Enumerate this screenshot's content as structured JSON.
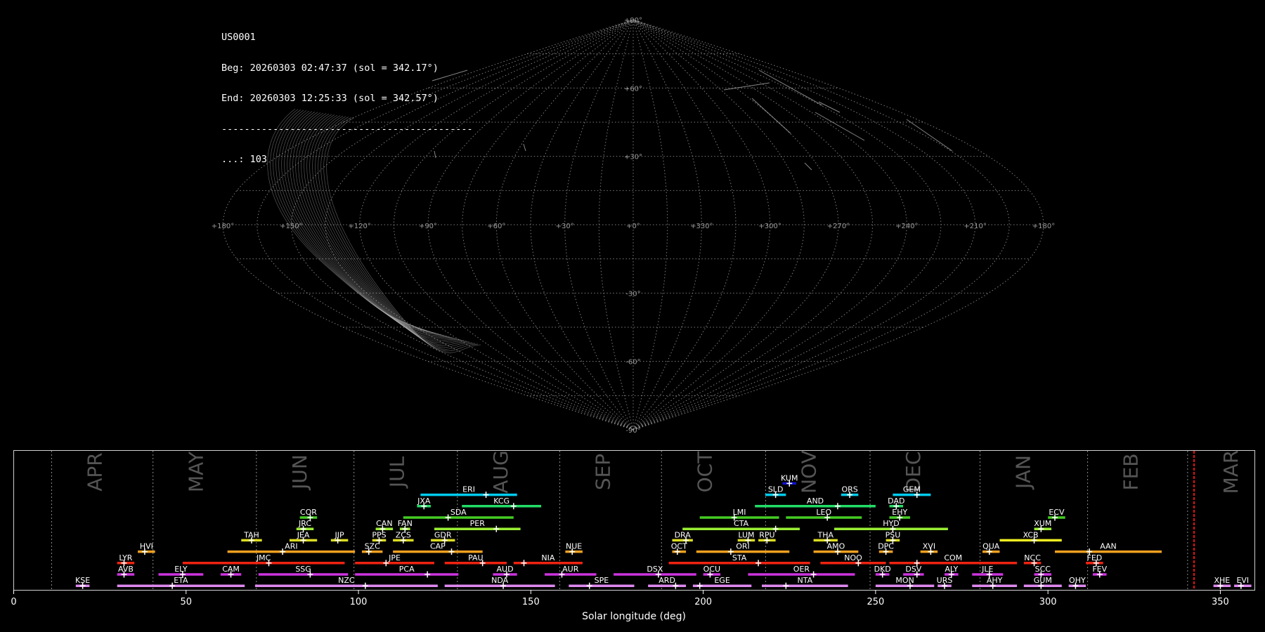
{
  "info": {
    "id": "US0001",
    "beg": "Beg: 20260303 02:47:37 (sol = 342.17°)",
    "end": "End: 20260303 12:25:33 (sol = 342.57°)",
    "sep": "--------------------------------------------",
    "count": "...: 103"
  },
  "skymap": {
    "lat_labels": [
      "+90°",
      "+60°",
      "+30°",
      "-30°",
      "-60°",
      "-90°"
    ],
    "lat_values": [
      90,
      60,
      30,
      -30,
      -60,
      -90
    ],
    "lon_labels": [
      "+180°",
      "+150°",
      "+120°",
      "+90°",
      "+60°",
      "+30°",
      "+0°",
      "+330°",
      "+300°",
      "+270°",
      "+240°",
      "+210°",
      "+180°"
    ],
    "grid_color": "#9a9a9a"
  },
  "chart_data": {
    "type": "timeline",
    "xlabel": "Solar longitude (deg)",
    "xlim": [
      0,
      360
    ],
    "xticks": [
      0,
      50,
      100,
      150,
      200,
      250,
      300,
      350
    ],
    "current_sol": 342.37,
    "months": [
      {
        "name": "APR",
        "start": 11
      },
      {
        "name": "MAY",
        "start": 40.4
      },
      {
        "name": "JUN",
        "start": 70.4
      },
      {
        "name": "JUL",
        "start": 98.7
      },
      {
        "name": "AUG",
        "start": 128.7
      },
      {
        "name": "SEP",
        "start": 158.4
      },
      {
        "name": "OCT",
        "start": 187.9
      },
      {
        "name": "NOV",
        "start": 218.1
      },
      {
        "name": "DEC",
        "start": 248.4
      },
      {
        "name": "JAN",
        "start": 280.3
      },
      {
        "name": "FEB",
        "start": 311.5
      },
      {
        "name": "MAR",
        "start": 340.5
      }
    ],
    "showers": [
      {
        "code": "KUM",
        "start": 223,
        "end": 227,
        "peak": 225,
        "row": 8,
        "color": "#1010d0"
      },
      {
        "code": "ERI",
        "start": 118,
        "end": 146,
        "peak": 137,
        "row": 7,
        "color": "#00ccee"
      },
      {
        "code": "SLD",
        "start": 218,
        "end": 224,
        "peak": 221,
        "row": 7,
        "color": "#00ccee"
      },
      {
        "code": "ORS",
        "start": 240,
        "end": 245,
        "peak": 242.5,
        "row": 7,
        "color": "#00ccee"
      },
      {
        "code": "GEM",
        "start": 255,
        "end": 266,
        "peak": 262,
        "row": 7,
        "color": "#00ccee"
      },
      {
        "code": "JXA",
        "start": 117,
        "end": 121,
        "peak": 119,
        "row": 6,
        "color": "#22dd66"
      },
      {
        "code": "KCG",
        "start": 130,
        "end": 153,
        "peak": 145,
        "row": 6,
        "color": "#22dd66"
      },
      {
        "code": "AND",
        "start": 215,
        "end": 250,
        "peak": 239,
        "row": 6,
        "color": "#22dd66"
      },
      {
        "code": "DAD",
        "start": 254,
        "end": 258,
        "peak": 256,
        "row": 6,
        "color": "#22dd66"
      },
      {
        "code": "COR",
        "start": 83,
        "end": 88,
        "peak": 86,
        "row": 5,
        "color": "#44cc22"
      },
      {
        "code": "SDA",
        "start": 113,
        "end": 145,
        "peak": 126,
        "row": 5,
        "color": "#44cc22"
      },
      {
        "code": "LMI",
        "start": 199,
        "end": 222,
        "peak": 209,
        "row": 5,
        "color": "#44cc22"
      },
      {
        "code": "LEO",
        "start": 224,
        "end": 246,
        "peak": 236,
        "row": 5,
        "color": "#44cc22"
      },
      {
        "code": "EHY",
        "start": 254,
        "end": 260,
        "peak": 257,
        "row": 5,
        "color": "#44cc22"
      },
      {
        "code": "ECV",
        "start": 300,
        "end": 305,
        "peak": 302,
        "row": 5,
        "color": "#44cc22"
      },
      {
        "code": "JRC",
        "start": 82,
        "end": 87,
        "peak": 84,
        "row": 4,
        "color": "#99ee33"
      },
      {
        "code": "CAN",
        "start": 105,
        "end": 110,
        "peak": 107,
        "row": 4,
        "color": "#99ee33"
      },
      {
        "code": "FAN",
        "start": 112,
        "end": 115,
        "peak": 113.5,
        "row": 4,
        "color": "#99ee33"
      },
      {
        "code": "PER",
        "start": 122,
        "end": 147,
        "peak": 140,
        "row": 4,
        "color": "#99ee33"
      },
      {
        "code": "CTA",
        "start": 194,
        "end": 228,
        "peak": 221,
        "row": 4,
        "color": "#99ee33"
      },
      {
        "code": "HYD",
        "start": 238,
        "end": 271,
        "peak": 255,
        "row": 4,
        "color": "#99ee33"
      },
      {
        "code": "XUM",
        "start": 296,
        "end": 301,
        "peak": 298,
        "row": 4,
        "color": "#99ee33"
      },
      {
        "code": "TAH",
        "start": 66,
        "end": 72,
        "peak": 69,
        "row": 3,
        "color": "#dddd22"
      },
      {
        "code": "JEA",
        "start": 80,
        "end": 88,
        "peak": 84,
        "row": 3,
        "color": "#dddd22"
      },
      {
        "code": "JIP",
        "start": 92,
        "end": 97,
        "peak": 94,
        "row": 3,
        "color": "#dddd22"
      },
      {
        "code": "PPS",
        "start": 104,
        "end": 108,
        "peak": 106,
        "row": 3,
        "color": "#dddd22"
      },
      {
        "code": "ZCS",
        "start": 110,
        "end": 116,
        "peak": 113,
        "row": 3,
        "color": "#dddd22"
      },
      {
        "code": "GDR",
        "start": 121,
        "end": 128,
        "peak": 125,
        "row": 3,
        "color": "#dddd22"
      },
      {
        "code": "DRA",
        "start": 191,
        "end": 197,
        "peak": 195,
        "row": 3,
        "color": "#dddd22"
      },
      {
        "code": "LUM",
        "start": 210,
        "end": 215,
        "peak": 213,
        "row": 3,
        "color": "#dddd22"
      },
      {
        "code": "RPU",
        "start": 216,
        "end": 221,
        "peak": 218.5,
        "row": 3,
        "color": "#dddd22"
      },
      {
        "code": "THA",
        "start": 232,
        "end": 239,
        "peak": 236,
        "row": 3,
        "color": "#dddd22"
      },
      {
        "code": "PSU",
        "start": 253,
        "end": 257,
        "peak": 255,
        "row": 3,
        "color": "#dddd22"
      },
      {
        "code": "XCB",
        "start": 286,
        "end": 304,
        "peak": 296,
        "row": 3,
        "color": "#eeee22"
      },
      {
        "code": "HVI",
        "start": 36,
        "end": 41,
        "peak": 38,
        "row": 2,
        "color": "#f0a020"
      },
      {
        "code": "ARI",
        "start": 62,
        "end": 99,
        "peak": 78,
        "row": 2,
        "color": "#f0a020"
      },
      {
        "code": "SZC",
        "start": 101,
        "end": 107,
        "peak": 103,
        "row": 2,
        "color": "#f0a020"
      },
      {
        "code": "CAP",
        "start": 110,
        "end": 136,
        "peak": 127,
        "row": 2,
        "color": "#f0a020"
      },
      {
        "code": "NUE",
        "start": 160,
        "end": 165,
        "peak": 162,
        "row": 2,
        "color": "#f0a020"
      },
      {
        "code": "OCT",
        "start": 191,
        "end": 195,
        "peak": 192.5,
        "row": 2,
        "color": "#f0a020"
      },
      {
        "code": "ORI",
        "start": 198,
        "end": 225,
        "peak": 208,
        "row": 2,
        "color": "#f0a020"
      },
      {
        "code": "AMO",
        "start": 232,
        "end": 245,
        "peak": 239,
        "row": 2,
        "color": "#f0a020"
      },
      {
        "code": "DPC",
        "start": 251,
        "end": 255,
        "peak": 253,
        "row": 2,
        "color": "#f0a020"
      },
      {
        "code": "XVI",
        "start": 263,
        "end": 268,
        "peak": 266,
        "row": 2,
        "color": "#f0a020"
      },
      {
        "code": "QUA",
        "start": 281,
        "end": 286,
        "peak": 283,
        "row": 2,
        "color": "#f0a020"
      },
      {
        "code": "AAN",
        "start": 302,
        "end": 333,
        "peak": 312,
        "row": 2,
        "color": "#f0a020"
      },
      {
        "code": "LYR",
        "start": 30,
        "end": 35,
        "peak": 32,
        "row": 1,
        "color": "#ee2211"
      },
      {
        "code": "JMC",
        "start": 49,
        "end": 96,
        "peak": 74,
        "row": 1,
        "color": "#ee2211"
      },
      {
        "code": "JPE",
        "start": 99,
        "end": 122,
        "peak": 108,
        "row": 1,
        "color": "#ee2211"
      },
      {
        "code": "PAU",
        "start": 125,
        "end": 143,
        "peak": 136,
        "row": 1,
        "color": "#ee2211"
      },
      {
        "code": "NIA",
        "start": 145,
        "end": 165,
        "peak": 148,
        "row": 1,
        "color": "#ee2211"
      },
      {
        "code": "STA",
        "start": 190,
        "end": 231,
        "peak": 216,
        "row": 1,
        "color": "#ee2211"
      },
      {
        "code": "NOO",
        "start": 234,
        "end": 253,
        "peak": 245,
        "row": 1,
        "color": "#ee2211"
      },
      {
        "code": "COM",
        "start": 254,
        "end": 291,
        "peak": 262,
        "row": 1,
        "color": "#ee2211"
      },
      {
        "code": "NCC",
        "start": 293,
        "end": 298,
        "peak": 296,
        "row": 1,
        "color": "#ee2211"
      },
      {
        "code": "FED",
        "start": 311,
        "end": 316,
        "peak": 314,
        "row": 1,
        "color": "#ee2211"
      },
      {
        "code": "AVB",
        "start": 30,
        "end": 35,
        "peak": 32,
        "row": 0,
        "color": "#cc33dd"
      },
      {
        "code": "ELY",
        "start": 42,
        "end": 55,
        "peak": 49,
        "row": 0,
        "color": "#cc33dd"
      },
      {
        "code": "CAM",
        "start": 60,
        "end": 66,
        "peak": 63,
        "row": 0,
        "color": "#cc33dd"
      },
      {
        "code": "SSG",
        "start": 71,
        "end": 97,
        "peak": 86,
        "row": 0,
        "color": "#cc33dd"
      },
      {
        "code": "PCA",
        "start": 99,
        "end": 129,
        "peak": 120,
        "row": 0,
        "color": "#cc33dd"
      },
      {
        "code": "AUD",
        "start": 139,
        "end": 146,
        "peak": 143,
        "row": 0,
        "color": "#cc33dd"
      },
      {
        "code": "AUR",
        "start": 154,
        "end": 169,
        "peak": 159,
        "row": 0,
        "color": "#cc33dd"
      },
      {
        "code": "DSX",
        "start": 174,
        "end": 198,
        "peak": 187,
        "row": 0,
        "color": "#cc33dd"
      },
      {
        "code": "OCU",
        "start": 200,
        "end": 205,
        "peak": 202,
        "row": 0,
        "color": "#cc33dd"
      },
      {
        "code": "OER",
        "start": 213,
        "end": 244,
        "peak": 232,
        "row": 0,
        "color": "#cc33dd"
      },
      {
        "code": "DKD",
        "start": 250,
        "end": 254,
        "peak": 252,
        "row": 0,
        "color": "#cc33dd"
      },
      {
        "code": "DSV",
        "start": 258,
        "end": 264,
        "peak": 262,
        "row": 0,
        "color": "#cc33dd"
      },
      {
        "code": "ALY",
        "start": 270,
        "end": 274,
        "peak": 272,
        "row": 0,
        "color": "#cc33dd"
      },
      {
        "code": "JLE",
        "start": 278,
        "end": 287,
        "peak": 283,
        "row": 0,
        "color": "#cc33dd"
      },
      {
        "code": "SCC",
        "start": 296,
        "end": 301,
        "peak": 298,
        "row": 0,
        "color": "#cc33dd"
      },
      {
        "code": "FEV",
        "start": 313,
        "end": 317,
        "peak": 315,
        "row": 0,
        "color": "#cc33dd"
      },
      {
        "code": "KSE",
        "start": 18,
        "end": 22,
        "peak": 20,
        "row": -1,
        "color": "#dd88ee"
      },
      {
        "code": "ETA",
        "start": 30,
        "end": 67,
        "peak": 46,
        "row": -1,
        "color": "#dd88ee"
      },
      {
        "code": "NZC",
        "start": 70,
        "end": 123,
        "peak": 102,
        "row": -1,
        "color": "#dd88ee"
      },
      {
        "code": "NDA",
        "start": 125,
        "end": 157,
        "peak": 142,
        "row": -1,
        "color": "#dd88ee"
      },
      {
        "code": "SPE",
        "start": 161,
        "end": 180,
        "peak": 167,
        "row": -1,
        "color": "#dd88ee"
      },
      {
        "code": "ARD",
        "start": 184,
        "end": 195,
        "peak": 192,
        "row": -1,
        "color": "#dd88ee"
      },
      {
        "code": "EGE",
        "start": 197,
        "end": 214,
        "peak": 199,
        "row": -1,
        "color": "#dd88ee"
      },
      {
        "code": "NTA",
        "start": 217,
        "end": 242,
        "peak": 224,
        "row": -1,
        "color": "#dd88ee"
      },
      {
        "code": "MON",
        "start": 250,
        "end": 267,
        "peak": 260,
        "row": -1,
        "color": "#dd88ee"
      },
      {
        "code": "URS",
        "start": 268,
        "end": 272,
        "peak": 270,
        "row": -1,
        "color": "#dd88ee"
      },
      {
        "code": "AHY",
        "start": 278,
        "end": 291,
        "peak": 284,
        "row": -1,
        "color": "#dd88ee"
      },
      {
        "code": "GUM",
        "start": 293,
        "end": 304,
        "peak": 298,
        "row": -1,
        "color": "#dd88ee"
      },
      {
        "code": "OHY",
        "start": 306,
        "end": 311,
        "peak": 308,
        "row": -1,
        "color": "#dd88ee"
      },
      {
        "code": "XHE",
        "start": 348,
        "end": 353,
        "peak": 350,
        "row": -1,
        "color": "#dd88ee"
      },
      {
        "code": "EVI",
        "start": 354,
        "end": 359,
        "peak": 356,
        "row": -1,
        "color": "#dd88ee"
      }
    ]
  }
}
